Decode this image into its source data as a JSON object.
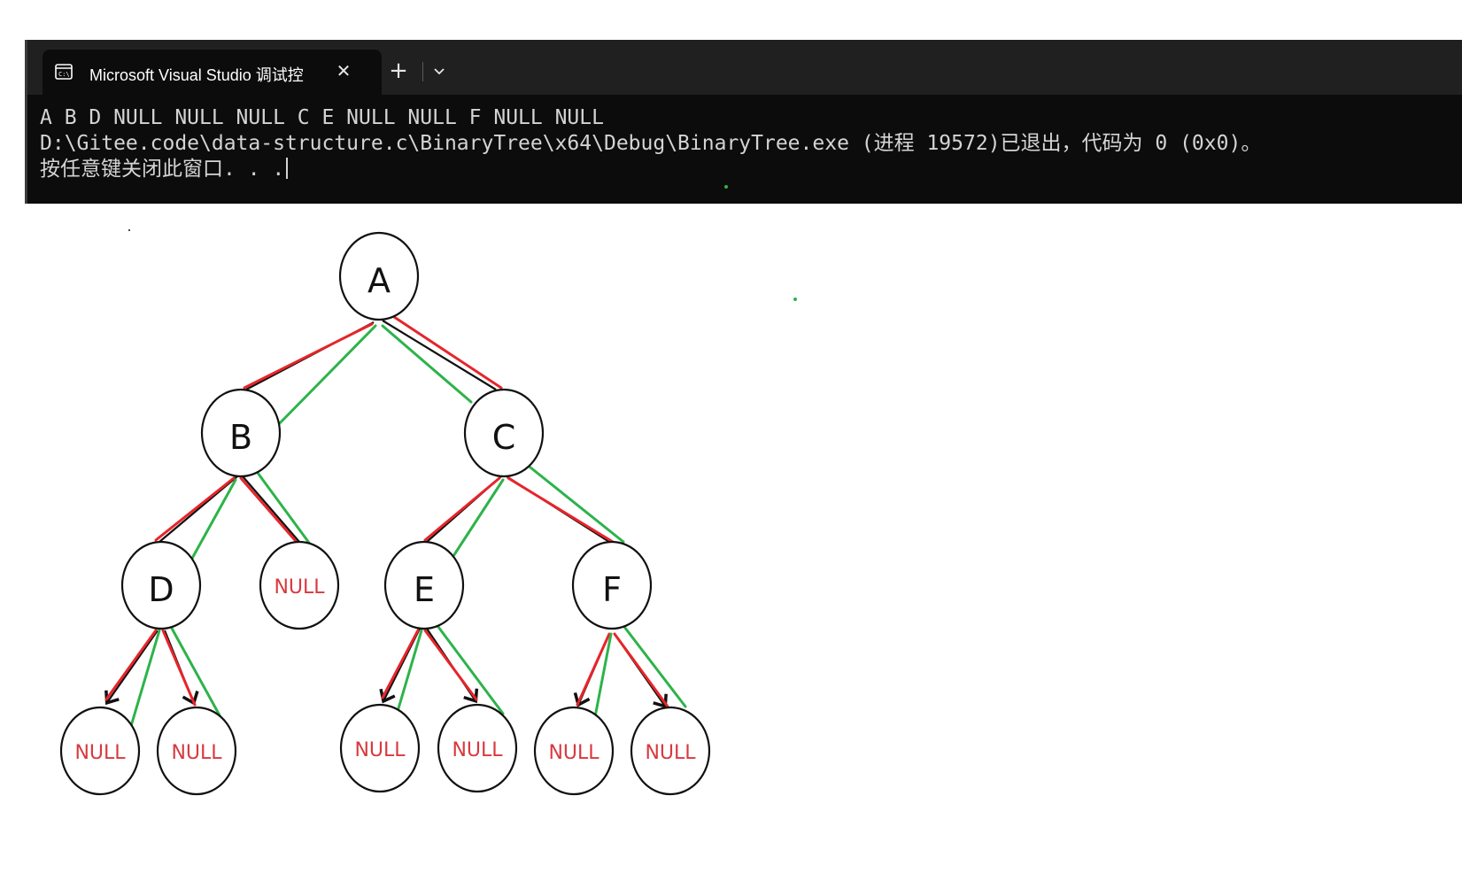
{
  "window": {
    "tab_title": "Microsoft Visual Studio 调试控",
    "tab_icon": "console-window-icon",
    "close_icon": "close-icon",
    "new_tab_icon": "plus-icon",
    "dropdown_icon": "chevron-down-icon"
  },
  "console": {
    "line1": "A B D NULL NULL NULL C E NULL NULL F NULL NULL",
    "line2": "D:\\Gitee.code\\data-structure.c\\BinaryTree\\x64\\Debug\\BinaryTree.exe (进程 19572)已退出，代码为 0 (0x0)。",
    "line3": "按任意键关闭此窗口. . ."
  },
  "tree": {
    "nodes": {
      "a": "A",
      "b": "B",
      "c": "C",
      "d": "D",
      "e": "E",
      "f": "F",
      "null1": "NULL",
      "null2": "NULL",
      "null3": "NULL",
      "null4": "NULL",
      "null5": "NULL",
      "null6": "NULL",
      "null7": "NULL"
    },
    "colors": {
      "red_path": "#e8242a",
      "green_path": "#2db34a",
      "null_text": "#d8393e"
    }
  }
}
